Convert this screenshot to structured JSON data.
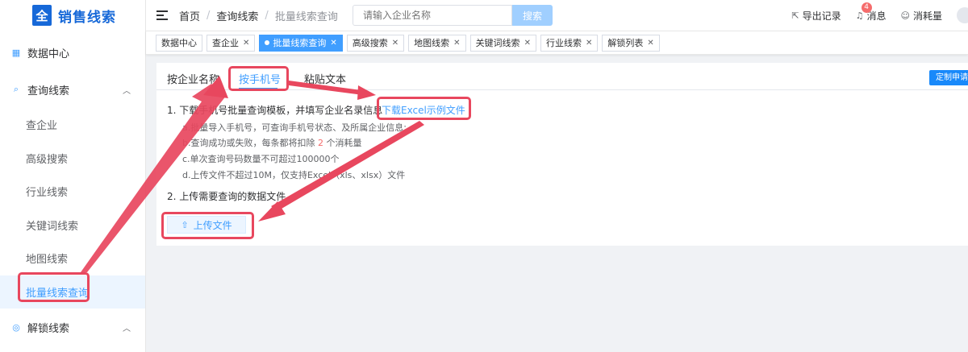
{
  "app": {
    "logo_mark": "全",
    "title": "销售线索"
  },
  "sidebar": {
    "groups": [
      {
        "label": "数据中心",
        "icon": "calendar-icon"
      },
      {
        "label": "查询线索",
        "icon": "search-list-icon",
        "chevron": "^"
      },
      {
        "label": "解锁线索",
        "icon": "globe-icon",
        "chevron": "^"
      }
    ],
    "sub_items": [
      "查企业",
      "高级搜索",
      "行业线索",
      "关键词线索",
      "地图线索",
      "批量线索查询"
    ],
    "active_sub": "批量线索查询"
  },
  "header": {
    "breadcrumb": [
      "首页",
      "查询线索",
      "批量线索查询"
    ],
    "search_placeholder": "请输入企业名称",
    "search_button": "搜索",
    "actions": [
      {
        "label": "导出记录",
        "icon": "export-icon"
      },
      {
        "label": "消息",
        "icon": "bell-icon",
        "badge": "4"
      },
      {
        "label": "消耗量",
        "icon": "smile-icon"
      }
    ]
  },
  "tags": [
    {
      "label": "数据中心",
      "closable": false
    },
    {
      "label": "查企业",
      "closable": true
    },
    {
      "label": "批量线索查询",
      "closable": true,
      "active": true
    },
    {
      "label": "高级搜索",
      "closable": true
    },
    {
      "label": "地图线索",
      "closable": true
    },
    {
      "label": "关键词线索",
      "closable": true
    },
    {
      "label": "行业线索",
      "closable": true
    },
    {
      "label": "解锁列表",
      "closable": true
    }
  ],
  "content": {
    "tabs": [
      "按企业名称",
      "按手机号",
      "粘贴文本"
    ],
    "active_tab": "按手机号",
    "custom_button": "定制申请",
    "step1": "1. 下载手机号批量查询模板，并填写企业名录信息",
    "download_link": "下载Excel示例文件",
    "notes": {
      "a": "a.批量导入手机号，可查询手机号状态、及所属企业信息;",
      "b_prefix": "b.查询成功或失败，每条都将扣除",
      "b_num": "2",
      "b_suffix": "个消耗量",
      "c": "c.单次查询号码数量不可超过100000个",
      "d": "d.上传文件不超过10M，仅支持Excel（xls、xlsx）文件"
    },
    "step2": "2. 上传需要查询的数据文件",
    "upload_button": "上传文件"
  },
  "colors": {
    "primary": "#409eff",
    "brand": "#1668d8",
    "annotation": "#e8475e",
    "badge": "#f56c6c"
  }
}
